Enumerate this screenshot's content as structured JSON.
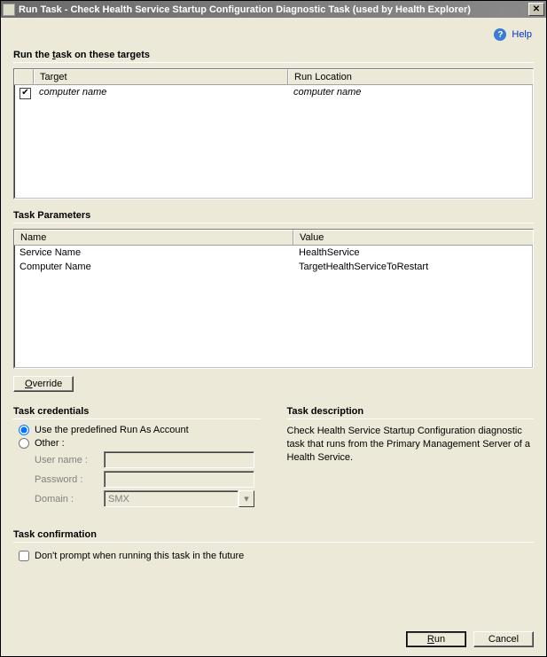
{
  "window": {
    "title": "Run Task - Check Health Service Startup Configuration Diagnostic Task (used by Health Explorer)"
  },
  "help": {
    "label": "Help"
  },
  "targets": {
    "section_label_pre": "Run the ",
    "section_label_u": "t",
    "section_label_post": "ask on these targets",
    "col_target": "Target",
    "col_runloc": "Run Location",
    "rows": [
      {
        "checked": true,
        "target": "computer name",
        "runloc": "computer name"
      }
    ]
  },
  "params": {
    "section_label": "Task Parameters",
    "col_name": "Name",
    "col_value": "Value",
    "rows": [
      {
        "name": "Service Name",
        "value": "HealthService"
      },
      {
        "name": "Computer Name",
        "value": "TargetHealthServiceToRestart"
      }
    ]
  },
  "buttons": {
    "override_u": "O",
    "override_post": "verride",
    "run_u": "R",
    "run_post": "un",
    "cancel": "Cancel"
  },
  "credentials": {
    "section_label": "Task credentials",
    "opt_predef": "Use the predefined Run As Account",
    "opt_other": "Other :",
    "username_u": "U",
    "username_post": "ser name :",
    "password_u": "P",
    "password_post": "assword :",
    "domain_u": "D",
    "domain_post": "omain :",
    "domain_value": "SMX",
    "selected": "predef"
  },
  "description": {
    "section_label": "Task description",
    "text": "Check Health Service Startup Configuration diagnostic task that runs from the Primary Management Server of a Health Service."
  },
  "confirmation": {
    "section_label": "Task confirmation",
    "checkbox_label": "Don't prompt when running this task in the future",
    "checked": false
  }
}
